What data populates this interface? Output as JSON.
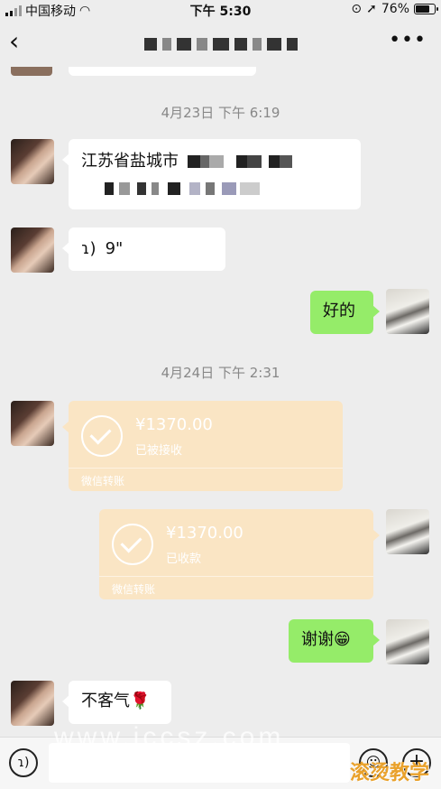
{
  "status_bar": {
    "carrier": "中国移动",
    "wifi_icon": "wifi-icon",
    "time": "下午 5:30",
    "battery_pct": "76%",
    "battery_level": 0.76
  },
  "nav": {
    "back_icon": "chevron-left-icon",
    "more_icon": "more-dots-icon",
    "more_glyph": "•••"
  },
  "messages": {
    "ts1": "4月23日 下午 6:19",
    "address_text": "江苏省盐城市",
    "voice_duration": "9\"",
    "reply_ok": "好的",
    "ts2": "4月24日 下午 2:31",
    "transfer_in": {
      "amount": "¥1370.00",
      "status": "已被接收",
      "source": "微信转账"
    },
    "transfer_out": {
      "amount": "¥1370.00",
      "status": "已收款",
      "source": "微信转账"
    },
    "thanks": "谢谢😁",
    "welcome": "不客气🌹"
  },
  "watermark": {
    "url": "www.jccsz.com",
    "brand": "滚烫教学"
  }
}
